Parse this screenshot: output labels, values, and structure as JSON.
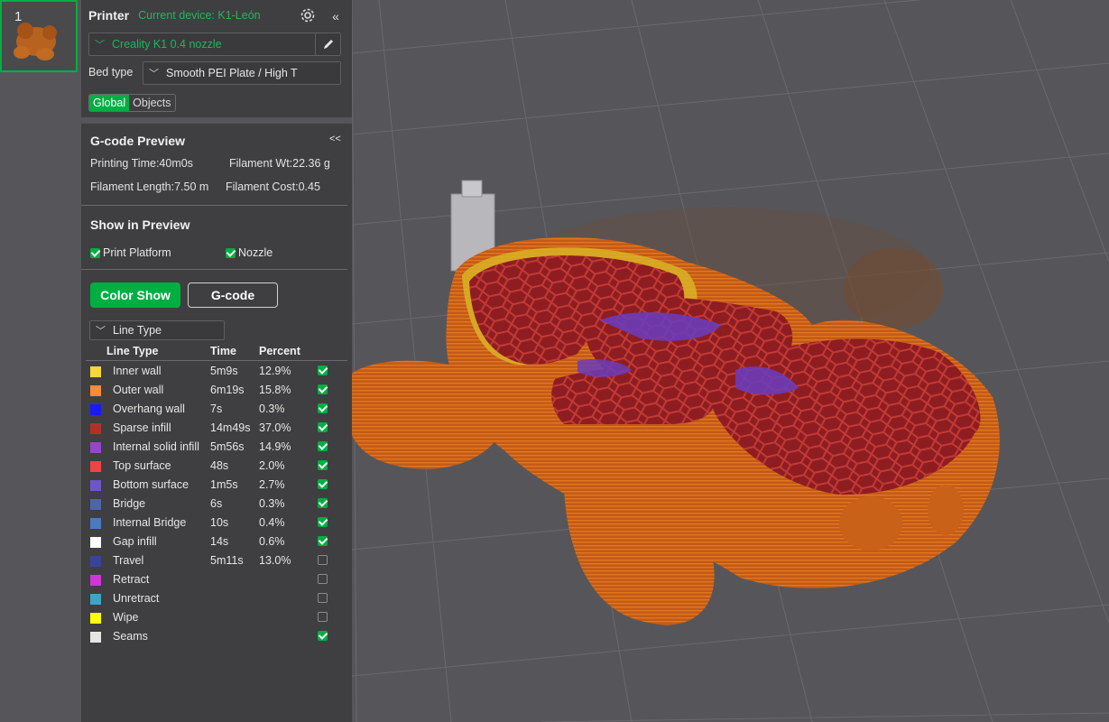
{
  "plate": {
    "number": "1"
  },
  "printer": {
    "title": "Printer",
    "current_device": "Current device: K1-León",
    "collapse": "«",
    "profile": "Creality K1 0.4 nozzle",
    "bed_type_label": "Bed type",
    "bed_type_value": "Smooth PEI Plate / High T",
    "tabs": [
      "Global",
      "Objects"
    ]
  },
  "gcode": {
    "title": "G-code Preview",
    "collapse": "<<",
    "printing_time": "Printing Time:40m0s",
    "filament_wt": "Filament Wt:22.36 g",
    "filament_length": "Filament Length:7.50 m",
    "filament_cost": "Filament Cost:0.45",
    "show_title": "Show in Preview",
    "print_platform": "Print Platform",
    "nozzle": "Nozzle",
    "color_show": "Color Show",
    "gcode_btn": "G-code",
    "view_select": "Line Type",
    "headers": {
      "type": "Line Type",
      "time": "Time",
      "percent": "Percent"
    }
  },
  "legend": [
    {
      "name": "Inner wall",
      "time": "5m9s",
      "percent": "12.9%",
      "color": "#f7d63a",
      "checked": true
    },
    {
      "name": "Outer wall",
      "time": "6m19s",
      "percent": "15.8%",
      "color": "#fb8a3b",
      "checked": true
    },
    {
      "name": "Overhang wall",
      "time": "7s",
      "percent": "0.3%",
      "color": "#1a1aff",
      "checked": true
    },
    {
      "name": "Sparse infill",
      "time": "14m49s",
      "percent": "37.0%",
      "color": "#b3302a",
      "checked": true
    },
    {
      "name": "Internal solid infill",
      "time": "5m56s",
      "percent": "14.9%",
      "color": "#9447c8",
      "checked": true
    },
    {
      "name": "Top surface",
      "time": "48s",
      "percent": "2.0%",
      "color": "#ee4444",
      "checked": true
    },
    {
      "name": "Bottom surface",
      "time": "1m5s",
      "percent": "2.7%",
      "color": "#6e56c8",
      "checked": true
    },
    {
      "name": "Bridge",
      "time": "6s",
      "percent": "0.3%",
      "color": "#4d66a8",
      "checked": true
    },
    {
      "name": "Internal Bridge",
      "time": "10s",
      "percent": "0.4%",
      "color": "#4a7abf",
      "checked": true
    },
    {
      "name": "Gap infill",
      "time": "14s",
      "percent": "0.6%",
      "color": "#ffffff",
      "checked": true
    },
    {
      "name": "Travel",
      "time": "5m11s",
      "percent": "13.0%",
      "color": "#39439b",
      "checked": false
    },
    {
      "name": "Retract",
      "time": "",
      "percent": "",
      "color": "#d135d8",
      "checked": false
    },
    {
      "name": "Unretract",
      "time": "",
      "percent": "",
      "color": "#3aa6c8",
      "checked": false
    },
    {
      "name": "Wipe",
      "time": "",
      "percent": "",
      "color": "#ffff00",
      "checked": false
    },
    {
      "name": "Seams",
      "time": "",
      "percent": "",
      "color": "#e6e6e6",
      "checked": true
    }
  ]
}
